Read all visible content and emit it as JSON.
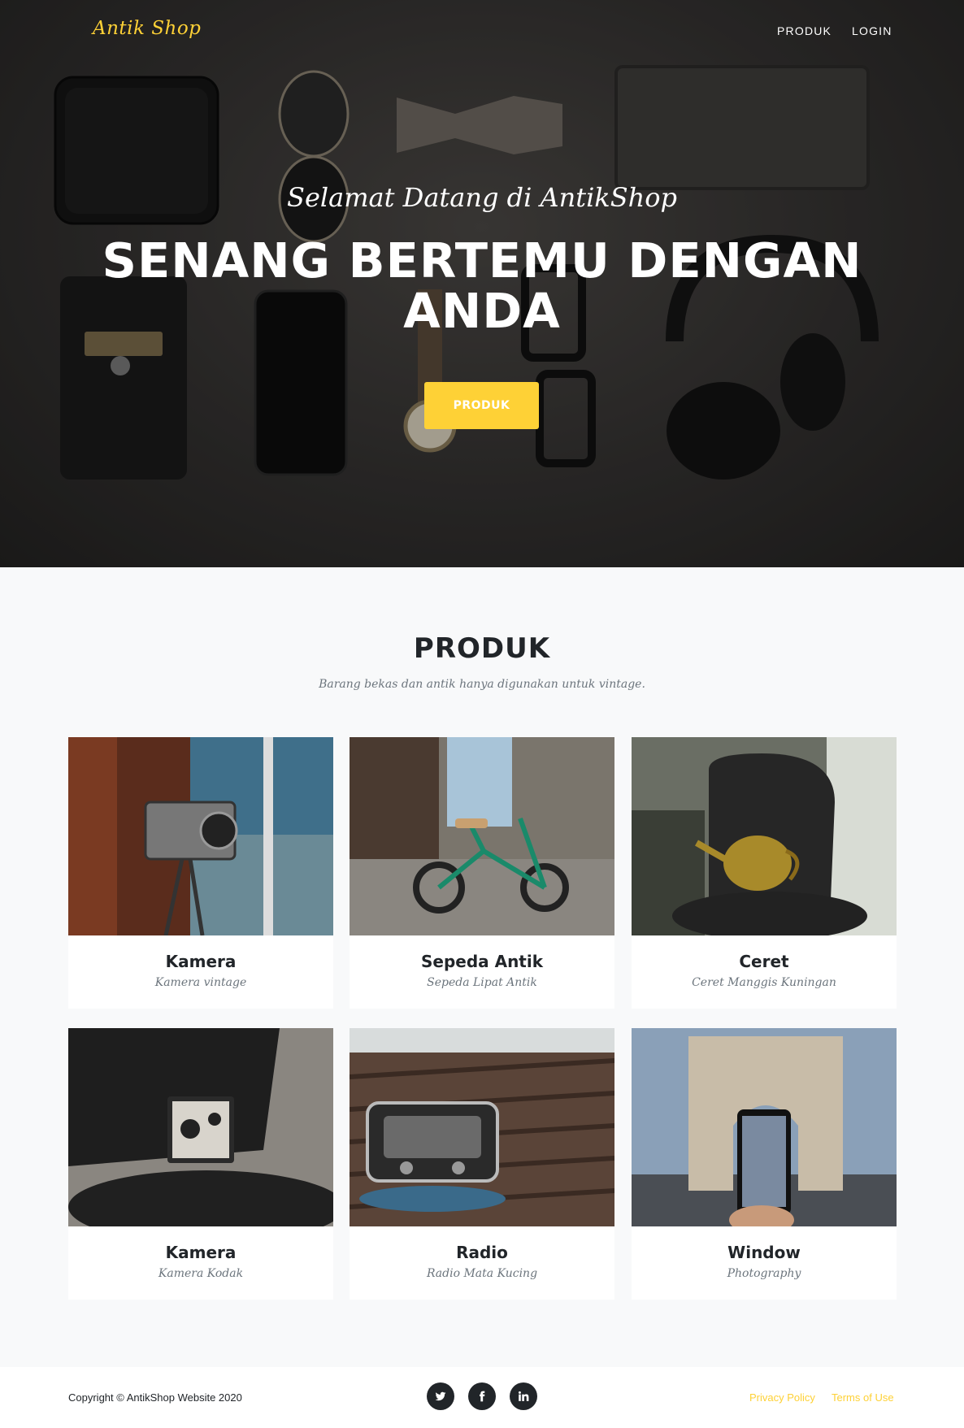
{
  "navbar": {
    "brand": "Antik Shop",
    "links": [
      {
        "label": "PRODUK"
      },
      {
        "label": "LOGIN"
      }
    ]
  },
  "hero": {
    "subtitle": "Selamat Datang di AntikShop",
    "title": "SENANG BERTEMU DENGAN ANDA",
    "button_label": "PRODUK"
  },
  "products": {
    "title": "PRODUK",
    "subtitle": "Barang bekas dan antik hanya digunakan untuk vintage.",
    "items": [
      {
        "name": "Kamera",
        "description": "Kamera vintage",
        "image": "vintage-camera-photo"
      },
      {
        "name": "Sepeda Antik",
        "description": "Sepeda Lipat Antik",
        "image": "folding-bike-photo"
      },
      {
        "name": "Ceret",
        "description": "Ceret Manggis Kuningan",
        "image": "brass-kettle-photo"
      },
      {
        "name": "Kamera",
        "description": "Kamera Kodak",
        "image": "kodak-camera-photo"
      },
      {
        "name": "Radio",
        "description": "Radio Mata Kucing",
        "image": "vintage-radio-photo"
      },
      {
        "name": "Window",
        "description": "Photography",
        "image": "arc-de-triomphe-photo"
      }
    ]
  },
  "footer": {
    "copyright": "Copyright © AntikShop Website 2020",
    "social": [
      {
        "icon": "twitter-icon"
      },
      {
        "icon": "facebook-icon"
      },
      {
        "icon": "linkedin-icon"
      }
    ],
    "links": [
      {
        "label": "Privacy Policy"
      },
      {
        "label": "Terms of Use"
      }
    ]
  },
  "colors": {
    "accent": "#fed136",
    "dark": "#212529",
    "muted": "#6c757d",
    "page_bg": "#f8f9fa"
  }
}
